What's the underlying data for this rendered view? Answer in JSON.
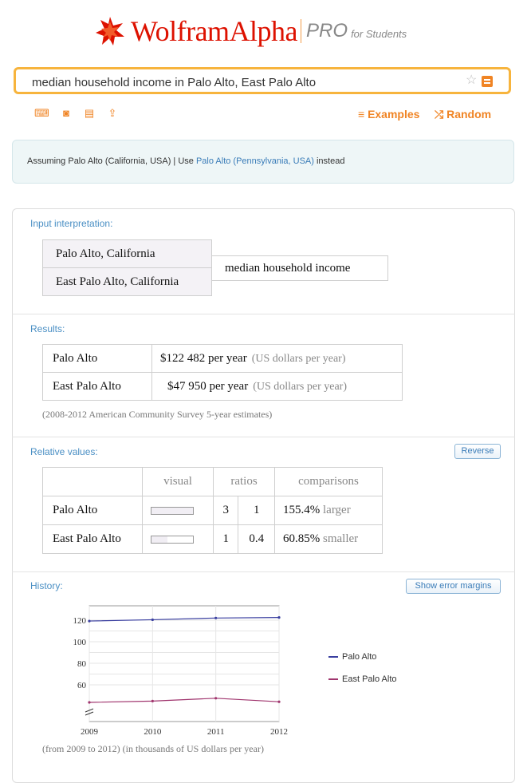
{
  "header": {
    "brand": "WolframAlpha",
    "brand_pro": "PRO",
    "brand_students": "for Students"
  },
  "search": {
    "query": "median household income in Palo Alto, East Palo Alto",
    "star_icon": "star-icon",
    "go_icon": "equals-button-icon"
  },
  "toolbar": {
    "icons": [
      "keyboard-icon",
      "camera-icon",
      "table-icon",
      "upload-icon"
    ],
    "examples_label": "Examples",
    "random_label": "Random"
  },
  "assumption": {
    "prefix": "Assuming Palo Alto (California, USA) | Use ",
    "link": "Palo Alto (Pennsylvania, USA)",
    "suffix": " instead"
  },
  "input_interpretation": {
    "title": "Input interpretation:",
    "places": [
      "Palo Alto, California",
      "East Palo Alto, California"
    ],
    "property": "median household income"
  },
  "results": {
    "title": "Results:",
    "rows": [
      {
        "place": "Palo Alto",
        "value": "$122 482 per year",
        "unit": "(US dollars per year)"
      },
      {
        "place": "East Palo Alto",
        "value": "$47 950 per year",
        "unit": "(US dollars per year)"
      }
    ],
    "note": "(2008-2012 American Community Survey 5-year estimates)"
  },
  "relative": {
    "title": "Relative values:",
    "reverse_label": "Reverse",
    "headers": {
      "visual": "visual",
      "ratios": "ratios",
      "comparisons": "comparisons"
    },
    "rows": [
      {
        "place": "Palo Alto",
        "bar_fraction": 1.0,
        "ratio_a": "3",
        "ratio_b": "1",
        "comp_value": "155.4%",
        "comp_word": "larger"
      },
      {
        "place": "East Palo Alto",
        "bar_fraction": 0.39,
        "ratio_a": "1",
        "ratio_b": "0.4",
        "comp_value": "60.85%",
        "comp_word": "smaller"
      }
    ]
  },
  "history": {
    "title": "History:",
    "error_btn": "Show error margins",
    "note": "(from 2009 to 2012)  (in thousands of US dollars per year)"
  },
  "chart_data": {
    "type": "line",
    "x": [
      2009,
      2010,
      2011,
      2012
    ],
    "series": [
      {
        "name": "Palo Alto",
        "values": [
          119.2,
          120.4,
          122.0,
          122.5
        ],
        "color": "#3a3fa0"
      },
      {
        "name": "East Palo Alto",
        "values": [
          47.5,
          48.3,
          50.1,
          47.9
        ],
        "color": "#a0356e"
      }
    ],
    "yticks": [
      "120",
      "100",
      "80",
      "60"
    ],
    "ytick_values": [
      120,
      100,
      80,
      60
    ],
    "xticks": [
      "2009",
      "2010",
      "2011",
      "2012"
    ],
    "axis_break": true,
    "legend": "right"
  }
}
